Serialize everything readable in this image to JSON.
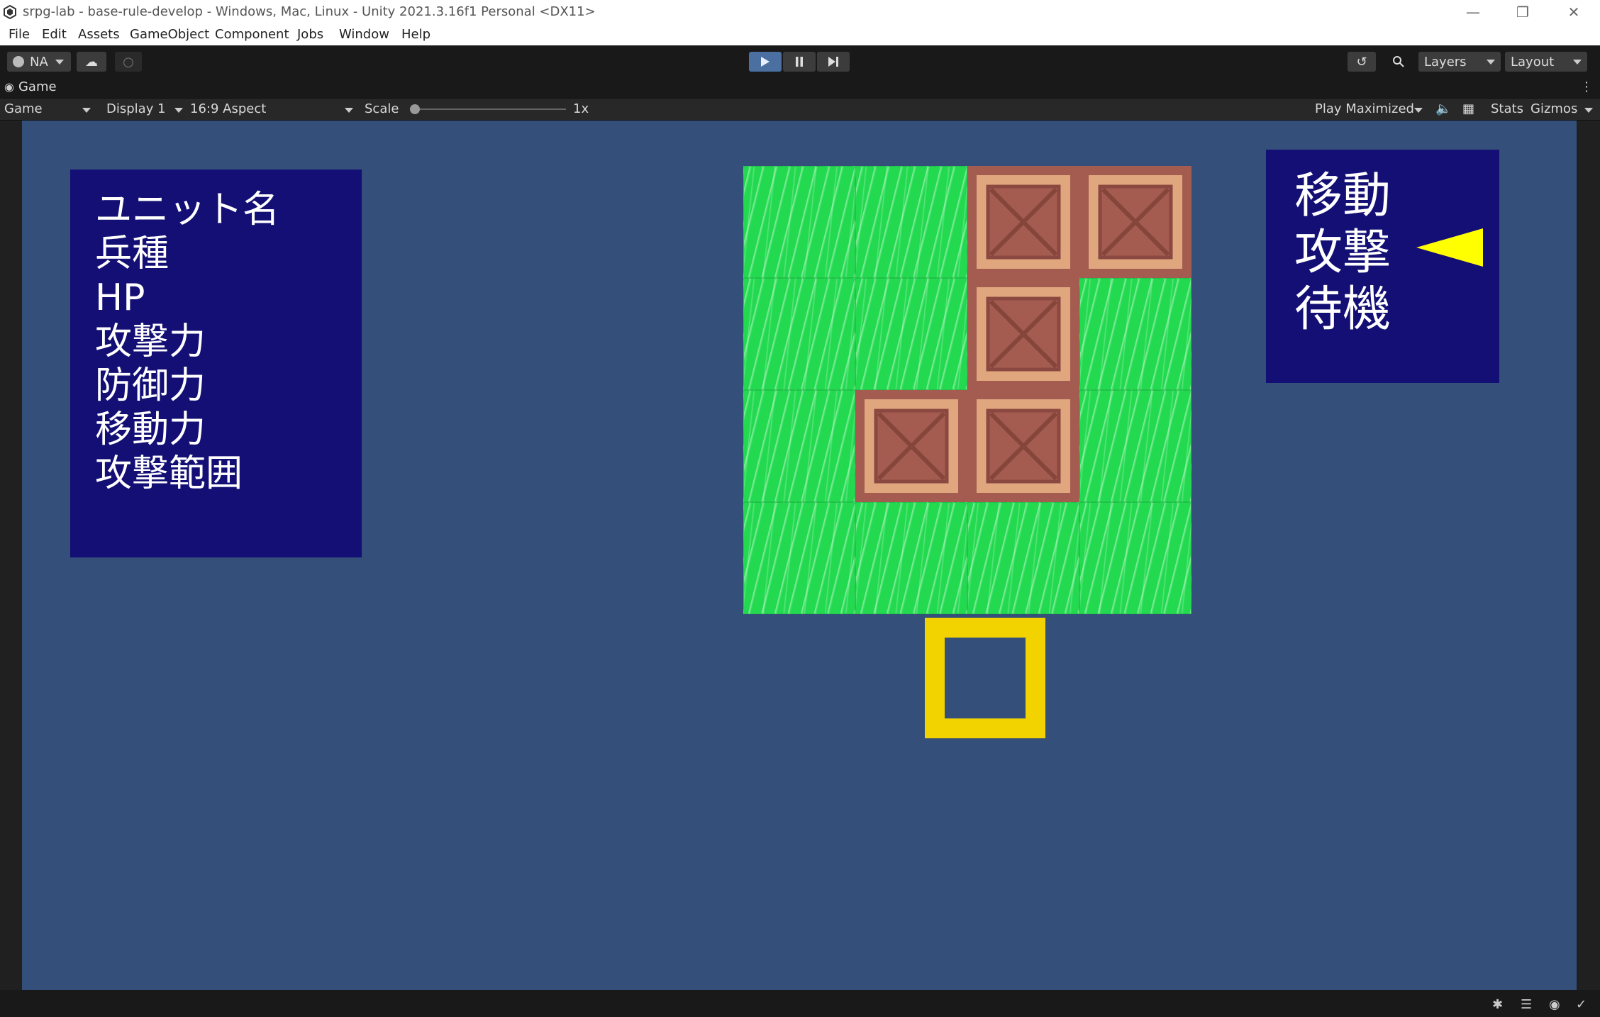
{
  "window": {
    "title": "srpg-lab - base-rule-develop - Windows, Mac, Linux - Unity 2021.3.16f1 Personal <DX11>"
  },
  "menu": [
    "File",
    "Edit",
    "Assets",
    "GameObject",
    "Component",
    "Jobs",
    "Window",
    "Help"
  ],
  "toolbar": {
    "account": "NA",
    "layers_label": "Layers",
    "layout_label": "Layout"
  },
  "tab": {
    "label": "Game"
  },
  "gamebar": {
    "mode": "Game",
    "display": "Display 1",
    "aspect": "16:9 Aspect",
    "scale_label": "Scale",
    "scale_value": "1x",
    "scale_fraction": 0.0,
    "play_mode": "Play Maximized",
    "stats": "Stats",
    "gizmos": "Gizmos"
  },
  "unit_info": {
    "lines": [
      "ユニット名",
      "兵種",
      "HP",
      "攻撃力",
      "防御力",
      "移動力",
      "攻撃範囲"
    ]
  },
  "command_menu": {
    "items": [
      "移動",
      "攻撃",
      "待機"
    ],
    "selected_index": 1
  },
  "board": {
    "rows": 4,
    "cols": 4,
    "tiles": [
      [
        "grass",
        "grass",
        "crate",
        "crate"
      ],
      [
        "grass",
        "grass",
        "crate",
        "grass"
      ],
      [
        "grass",
        "crate",
        "crate",
        "grass"
      ],
      [
        "grass",
        "grass",
        "grass",
        "grass"
      ]
    ],
    "cursor_cell": {
      "row": 3,
      "col": 1.5
    }
  },
  "colors": {
    "viewport_bg": "#34507a",
    "panel_bg": "#130f74",
    "grass": "#22d94f",
    "wall": "#a45c50",
    "crate": "#e0a77f",
    "selector": "#f2d300",
    "menu_cursor": "#ffff00"
  },
  "icons": [
    "unity-logo-icon",
    "minimize-icon",
    "restore-icon",
    "close-icon",
    "account-icon",
    "cloud-icon",
    "collab-icon",
    "play-icon",
    "pause-icon",
    "step-icon",
    "history-icon",
    "search-icon",
    "gamepad-icon",
    "audio-icon",
    "keyboard-icon",
    "kebab-menu-icon",
    "bug-icon",
    "layers-status-icon",
    "visibility-icon",
    "check-icon"
  ]
}
